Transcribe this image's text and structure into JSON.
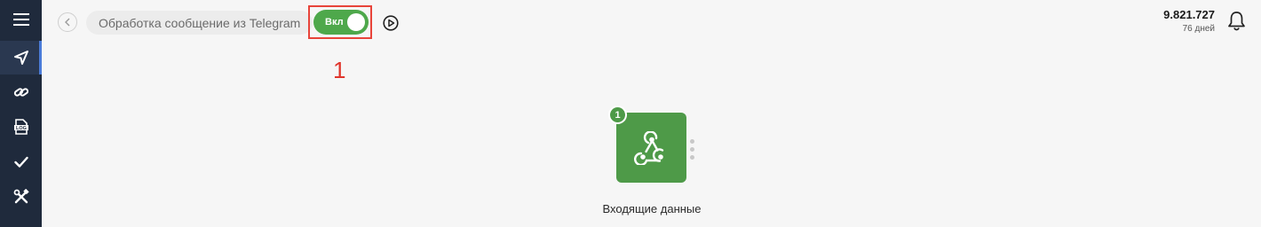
{
  "sidebar": {
    "items": [
      {
        "icon": "hamburger-menu-icon"
      },
      {
        "icon": "send-plane-icon",
        "active": true
      },
      {
        "icon": "link-icon"
      },
      {
        "icon": "log-file-icon",
        "text": "LOG"
      },
      {
        "icon": "checkmark-icon"
      },
      {
        "icon": "tools-icon"
      }
    ],
    "background": "#1f2a3c",
    "active_accent": "#4a7bd8"
  },
  "header": {
    "back_icon": "chevron-left-icon",
    "title": "Обработка сообщение из Telegram",
    "toggle": {
      "label": "Вкл",
      "state": "on",
      "color": "#4ea84b"
    },
    "play_icon": "play-circle-icon"
  },
  "annotation": {
    "number": "1",
    "color": "#e0352b"
  },
  "account": {
    "balance": "9.821.727",
    "days": "76 дней",
    "bell_icon": "bell-icon"
  },
  "canvas": {
    "node": {
      "badge": "1",
      "icon": "webhook-icon",
      "label": "Входящие данные",
      "color": "#4e9a48"
    }
  }
}
